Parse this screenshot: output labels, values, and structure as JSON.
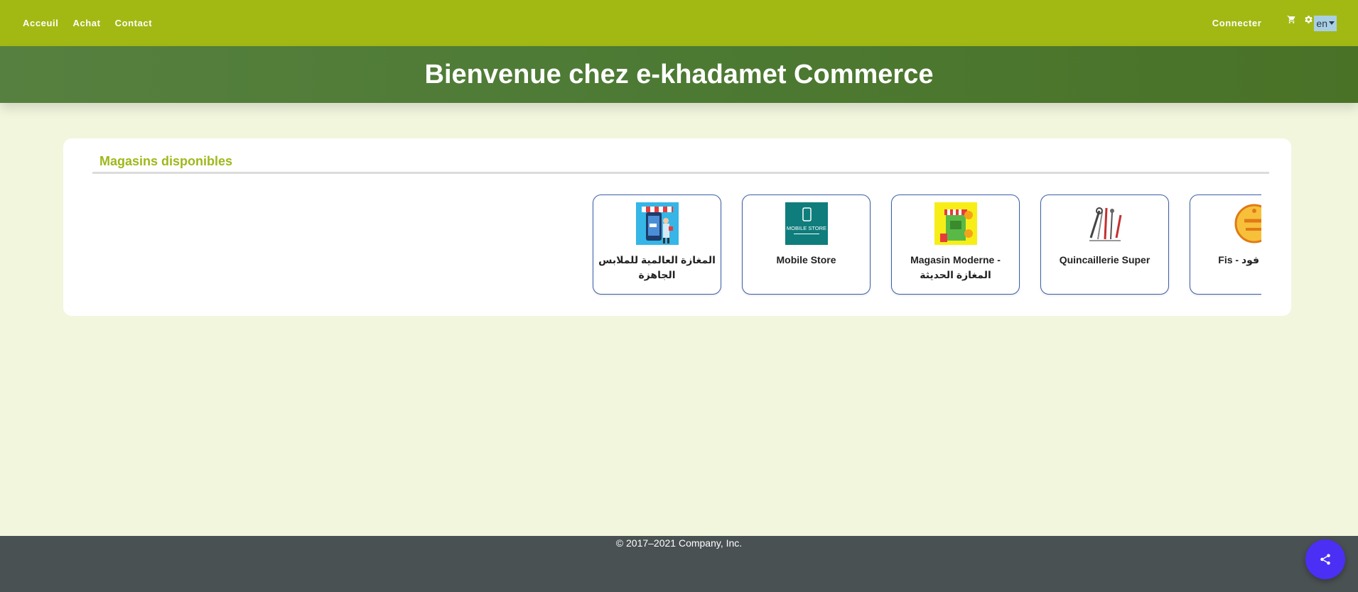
{
  "nav": {
    "links": [
      "Acceuil",
      "Achat",
      "Contact"
    ],
    "connect_label": "Connecter",
    "cart_icon": "cart-icon",
    "settings_icon": "gear-icon",
    "language": "en"
  },
  "hero": {
    "title": "Bienvenue chez e-khadamet Commerce"
  },
  "stores": {
    "title": "Magasins disponibles",
    "items": [
      {
        "name": "المغازة العالمية للملابس الجاهزة",
        "logo": "clothing-store-logo"
      },
      {
        "name": "Mobile Store",
        "logo": "mobile-store-logo",
        "logo_text": "MOBILE STORE"
      },
      {
        "name": "Magasin Moderne - المغازة الحديثة",
        "logo": "modern-store-logo"
      },
      {
        "name": "Quincaillerie Super",
        "logo": "hardware-tools-logo"
      },
      {
        "name": "Fis - فيسع فود",
        "logo": "restaurant-food-logo"
      }
    ]
  },
  "footer": {
    "copyright": "© 2017–2021 Company, Inc."
  },
  "fab": {
    "icon": "share-icon"
  },
  "colors": {
    "topbar": "#a2b914",
    "hero": "#4c7a33",
    "accent": "#9fb81a",
    "footer": "#4a5152",
    "fab": "#4b2ff5",
    "card_border": "#3b5fa8"
  }
}
